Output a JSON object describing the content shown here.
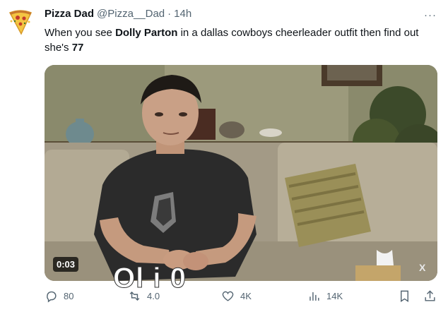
{
  "tweet": {
    "author_name": "Pizza Dad",
    "author_handle": "@Pizza__Dad",
    "separator": "·",
    "time": "14h",
    "more_label": "···",
    "text_part1": "When you see ",
    "text_bold1": "Dolly Parton",
    "text_part2": " in a dallas cowboys cheerleader outfit then find out she's ",
    "text_bold2": "77"
  },
  "media": {
    "duration": "0:03",
    "caption": "Ol   i   0"
  },
  "actions": {
    "reply_count": "80",
    "retweet_count": "4.0",
    "like_count": "4K",
    "views_count": "14K",
    "reply_icon": "reply-icon",
    "retweet_icon": "retweet-icon",
    "like_icon": "heart-icon",
    "views_icon": "views-icon",
    "bookmark_icon": "bookmark-icon",
    "share_icon": "share-icon"
  },
  "colors": {
    "text_primary": "#0f1419",
    "text_secondary": "#536471"
  }
}
